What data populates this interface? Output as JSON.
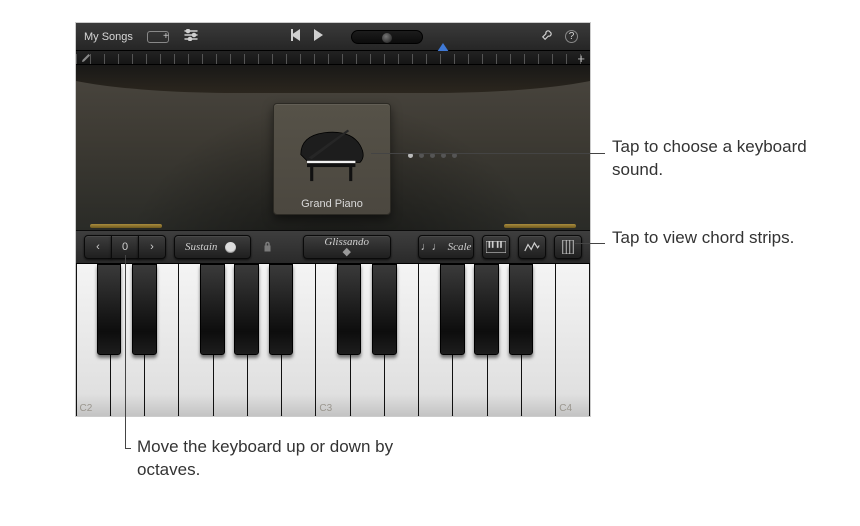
{
  "toolbar": {
    "back_label": "My Songs"
  },
  "instrument": {
    "name": "Grand Piano"
  },
  "controls": {
    "octave_value": "0",
    "sustain_label": "Sustain",
    "glissando_label": "Glissando",
    "scale_label": "Scale",
    "scale_glyph": "♩♩"
  },
  "octave_labels": [
    "C2",
    "C3",
    "C4"
  ],
  "callouts": {
    "sound": "Tap to choose a keyboard sound.",
    "chord_strips": "Tap to view chord strips.",
    "octaves": "Move the keyboard up or down by octaves."
  }
}
